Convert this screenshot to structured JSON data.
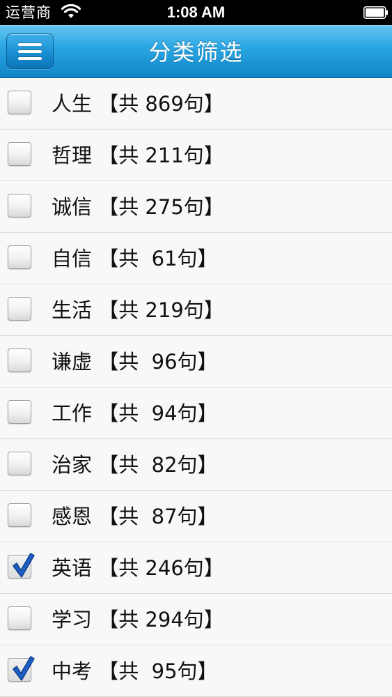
{
  "status_bar": {
    "carrier": "运营商",
    "time": "1:08 AM"
  },
  "nav": {
    "title": "分类筛选",
    "menu_icon": "hamburger-menu-icon"
  },
  "categories": [
    {
      "label": "人生 【共 869句】",
      "checked": false
    },
    {
      "label": "哲理 【共 211句】",
      "checked": false
    },
    {
      "label": "诚信 【共 275句】",
      "checked": false
    },
    {
      "label": "自信 【共  61句】",
      "checked": false
    },
    {
      "label": "生活 【共 219句】",
      "checked": false
    },
    {
      "label": "谦虚 【共  96句】",
      "checked": false
    },
    {
      "label": "工作 【共  94句】",
      "checked": false
    },
    {
      "label": "治家 【共  82句】",
      "checked": false
    },
    {
      "label": "感恩 【共  87句】",
      "checked": false
    },
    {
      "label": "英语 【共 246句】",
      "checked": true
    },
    {
      "label": "学习 【共 294句】",
      "checked": false
    },
    {
      "label": "中考 【共  95句】",
      "checked": true
    }
  ],
  "colors": {
    "nav_blue": "#1a96d6",
    "check_blue": "#1d5fc4"
  }
}
